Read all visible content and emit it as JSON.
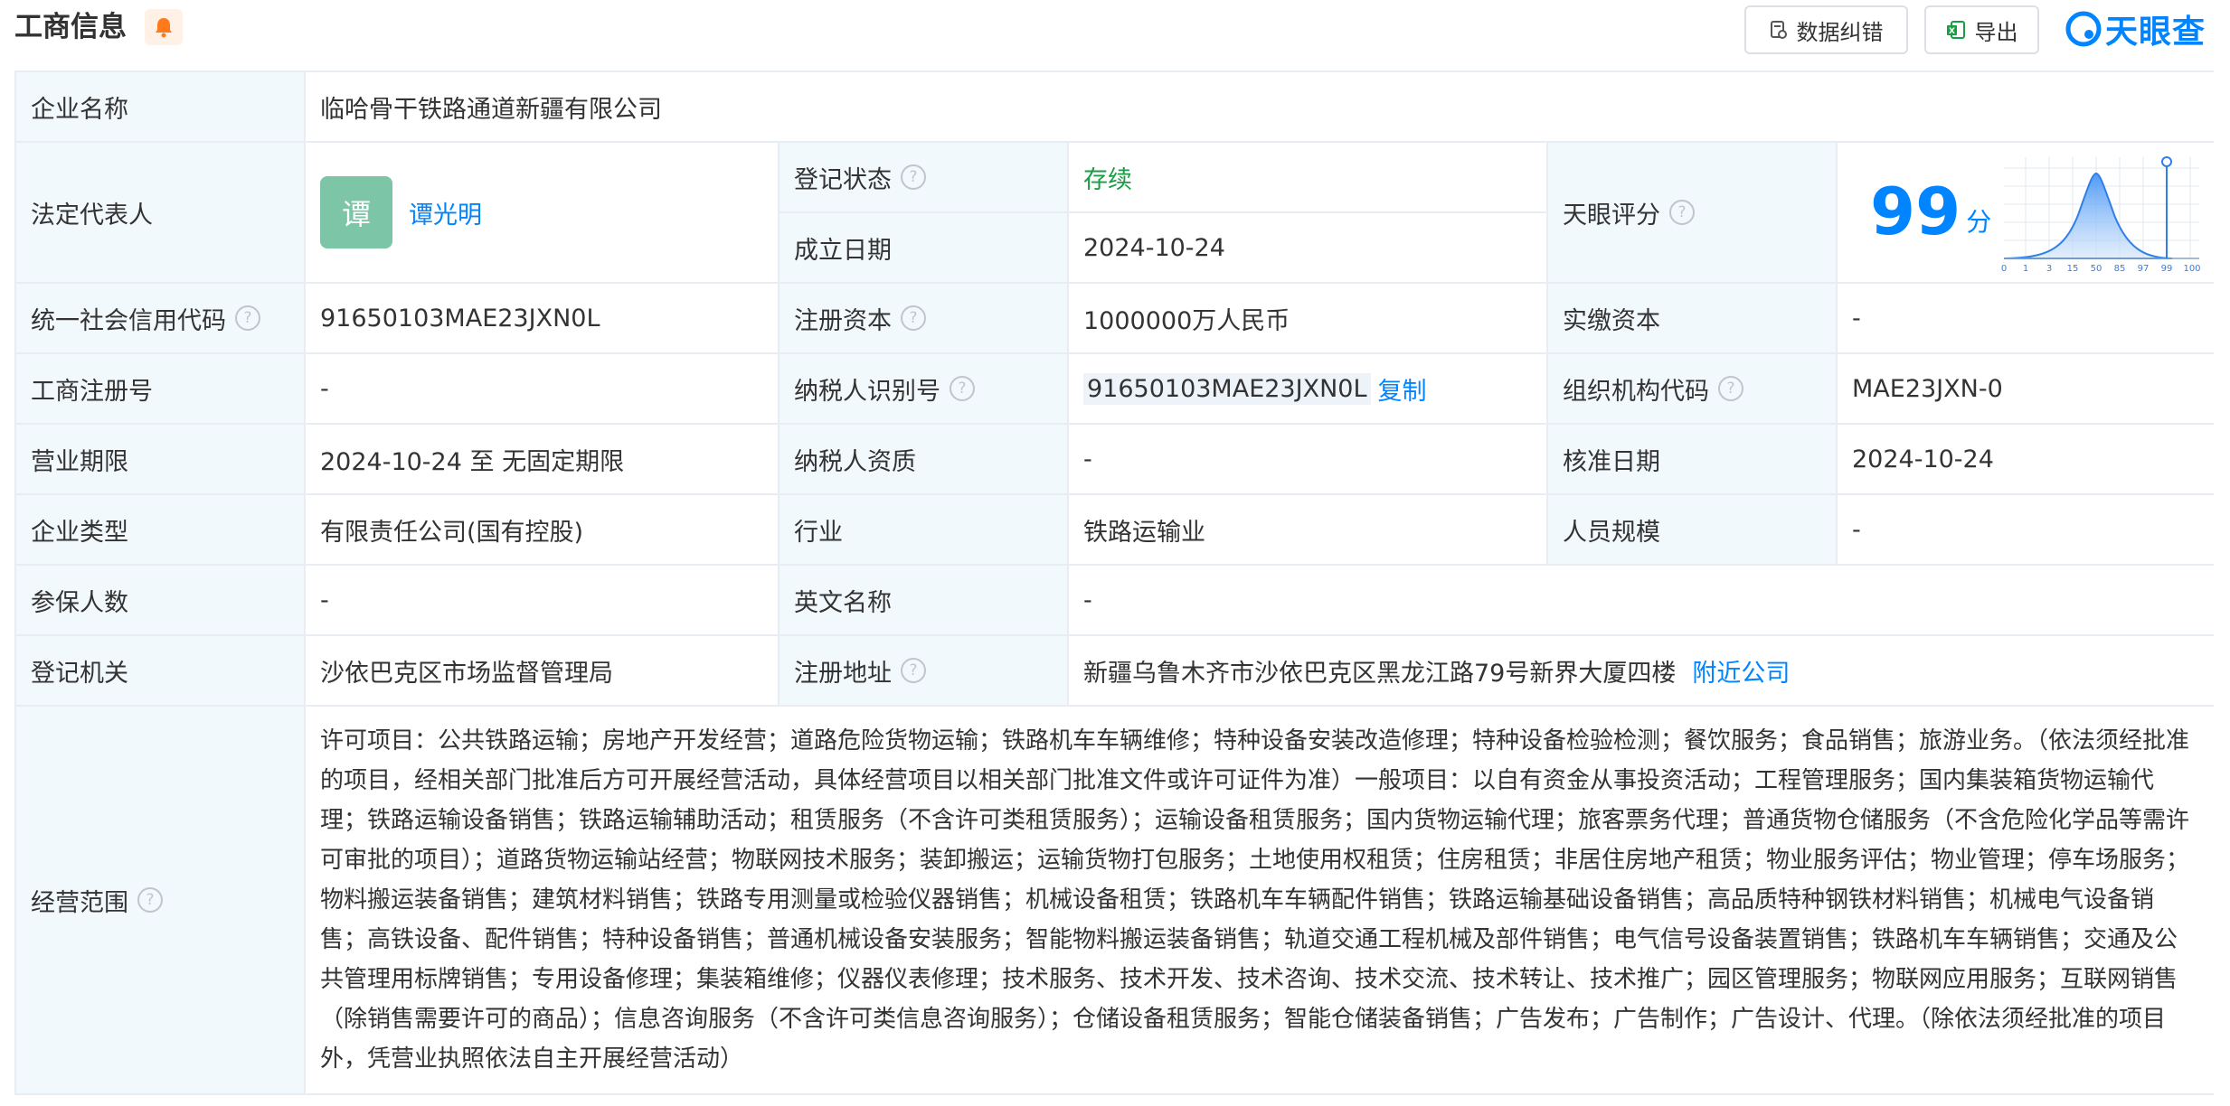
{
  "header": {
    "title": "工商信息",
    "report_button": "数据纠错",
    "export_button": "导出",
    "logo_text": "天眼查"
  },
  "colors": {
    "accent": "#0084ff",
    "status_green": "#1a9e45",
    "label_bg": "#f2f9fc",
    "bell": "#ff7a1a"
  },
  "company": {
    "name_label": "企业名称",
    "name": "临哈骨干铁路通道新疆有限公司",
    "legal_rep_label": "法定代表人",
    "legal_rep_avatar": "谭",
    "legal_rep": "谭光明",
    "status_label": "登记状态",
    "status": "存续",
    "established_label": "成立日期",
    "established": "2024-10-24",
    "rating_label": "天眼评分",
    "rating": "99",
    "rating_unit": "分",
    "rating_axis": [
      "0",
      "1",
      "3",
      "15",
      "50",
      "85",
      "97",
      "99",
      "100"
    ],
    "credit_code_label": "统一社会信用代码",
    "credit_code": "91650103MAE23JXN0L",
    "reg_capital_label": "注册资本",
    "reg_capital": "1000000万人民币",
    "paid_capital_label": "实缴资本",
    "paid_capital": "-",
    "biz_reg_no_label": "工商注册号",
    "biz_reg_no": "-",
    "taxpayer_id_label": "纳税人识别号",
    "taxpayer_id": "91650103MAE23JXN0L",
    "copy_label": "复制",
    "org_code_label": "组织机构代码",
    "org_code": "MAE23JXN-0",
    "term_label": "营业期限",
    "term": "2024-10-24 至 无固定期限",
    "taxpayer_qual_label": "纳税人资质",
    "taxpayer_qual": "-",
    "approval_date_label": "核准日期",
    "approval_date": "2024-10-24",
    "type_label": "企业类型",
    "type": "有限责任公司(国有控股)",
    "industry_label": "行业",
    "industry": "铁路运输业",
    "staff_size_label": "人员规模",
    "staff_size": "-",
    "insured_label": "参保人数",
    "insured": "-",
    "english_name_label": "英文名称",
    "english_name": "-",
    "authority_label": "登记机关",
    "authority": "沙依巴克区市场监督管理局",
    "address_label": "注册地址",
    "address": "新疆乌鲁木齐市沙依巴克区黑龙江路79号新界大厦四楼",
    "nearby_label": "附近公司",
    "scope_label": "经营范围",
    "scope": "许可项目：公共铁路运输；房地产开发经营；道路危险货物运输；铁路机车车辆维修；特种设备安装改造修理；特种设备检验检测；餐饮服务；食品销售；旅游业务。（依法须经批准的项目，经相关部门批准后方可开展经营活动，具体经营项目以相关部门批准文件或许可证件为准）一般项目：以自有资金从事投资活动；工程管理服务；国内集装箱货物运输代理；铁路运输设备销售；铁路运输辅助活动；租赁服务（不含许可类租赁服务）；运输设备租赁服务；国内货物运输代理；旅客票务代理；普通货物仓储服务（不含危险化学品等需许可审批的项目）；道路货物运输站经营；物联网技术服务；装卸搬运；运输货物打包服务；土地使用权租赁；住房租赁；非居住房地产租赁；物业服务评估；物业管理；停车场服务；物料搬运装备销售；建筑材料销售；铁路专用测量或检验仪器销售；机械设备租赁；铁路机车车辆配件销售；铁路运输基础设备销售；高品质特种钢铁材料销售；机械电气设备销售；高铁设备、配件销售；特种设备销售；普通机械设备安装服务；智能物料搬运装备销售；轨道交通工程机械及部件销售；电气信号设备装置销售；铁路机车车辆销售；交通及公共管理用标牌销售；专用设备修理；集装箱维修；仪器仪表修理；技术服务、技术开发、技术咨询、技术交流、技术转让、技术推广；园区管理服务；物联网应用服务；互联网销售（除销售需要许可的商品）；信息咨询服务（不含许可类信息咨询服务）；仓储设备租赁服务；智能仓储装备销售；广告发布；广告制作；广告设计、代理。（除依法须经批准的项目外，凭营业执照依法自主开展经营活动）"
  }
}
